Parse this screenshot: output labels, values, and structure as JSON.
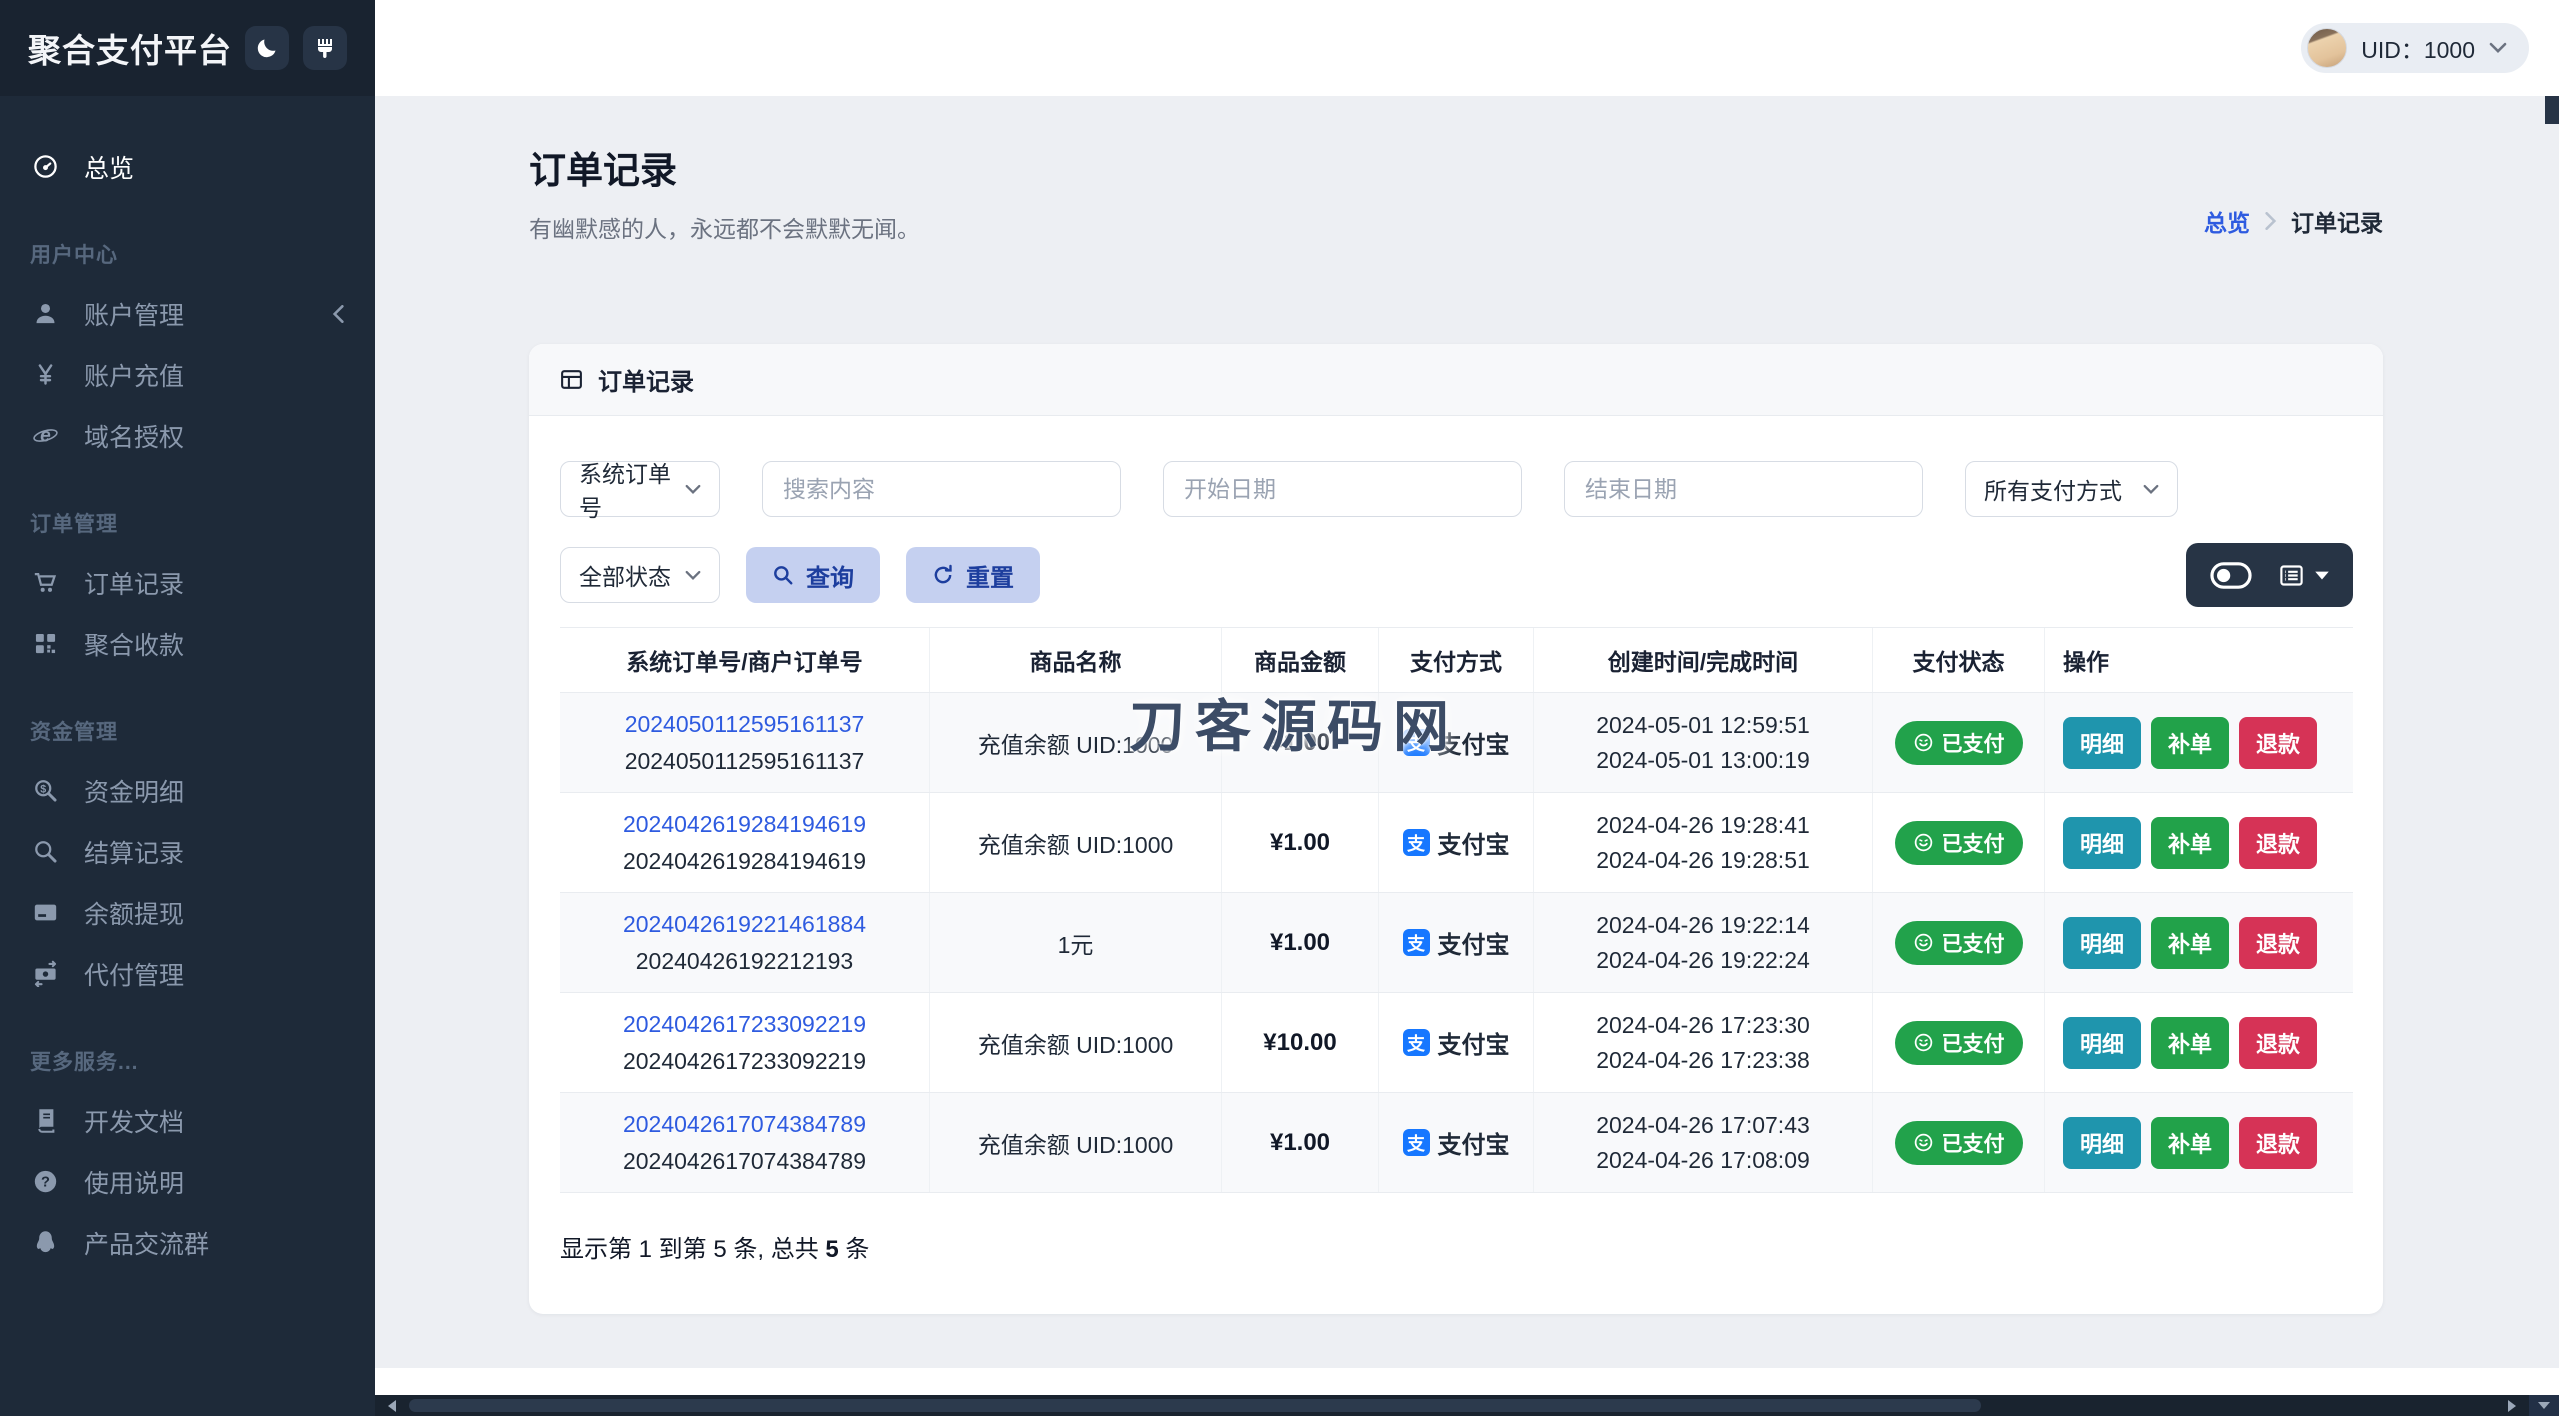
{
  "app_title": "聚合支付平台",
  "topbar": {
    "uid": "UID：1000"
  },
  "sidebar": {
    "sections": [
      {
        "label": "",
        "items": [
          {
            "icon": "gauge-icon",
            "label": "总览",
            "active": true
          }
        ]
      },
      {
        "label": "用户中心",
        "items": [
          {
            "icon": "user-icon",
            "label": "账户管理",
            "chevron": true
          },
          {
            "icon": "yen-icon",
            "label": "账户充值"
          },
          {
            "icon": "globe-icon",
            "label": "域名授权"
          }
        ]
      },
      {
        "label": "订单管理",
        "items": [
          {
            "icon": "cart-icon",
            "label": "订单记录"
          },
          {
            "icon": "qrcode-icon",
            "label": "聚合收款"
          }
        ]
      },
      {
        "label": "资金管理",
        "items": [
          {
            "icon": "search-dollar-icon",
            "label": "资金明细"
          },
          {
            "icon": "search-icon",
            "label": "结算记录"
          },
          {
            "icon": "card-icon",
            "label": "余额提现"
          },
          {
            "icon": "transfer-icon",
            "label": "代付管理"
          }
        ]
      },
      {
        "label": "更多服务...",
        "items": [
          {
            "icon": "book-icon",
            "label": "开发文档"
          },
          {
            "icon": "question-icon",
            "label": "使用说明"
          },
          {
            "icon": "qq-icon",
            "label": "产品交流群"
          }
        ]
      }
    ]
  },
  "page": {
    "title": "订单记录",
    "subtitle": "有幽默感的人，永远都不会默默无闻。",
    "breadcrumb_home": "总览",
    "breadcrumb_current": "订单记录"
  },
  "card": {
    "title": "订单记录",
    "filters": {
      "order_field": "系统订单号",
      "search_placeholder": "搜索内容",
      "start_placeholder": "开始日期",
      "end_placeholder": "结束日期",
      "pay_method": "所有支付方式",
      "status": "全部状态",
      "query": "查询",
      "reset": "重置"
    },
    "table": {
      "headers": [
        "系统订单号/商户订单号",
        "商品名称",
        "商品金额",
        "支付方式",
        "创建时间/完成时间",
        "支付状态",
        "操作"
      ],
      "pay_label": "支付宝",
      "alipay_glyph": "支",
      "status_label": "已支付",
      "actions": [
        "明细",
        "补单",
        "退款"
      ],
      "rows": [
        {
          "sys_no": "2024050112595161137",
          "merchant_no": "2024050112595161137",
          "product": "充值余额 UID:1000",
          "amount": "¥1.00",
          "created": "2024-05-01 12:59:51",
          "completed": "2024-05-01 13:00:19"
        },
        {
          "sys_no": "2024042619284194619",
          "merchant_no": "2024042619284194619",
          "product": "充值余额 UID:1000",
          "amount": "¥1.00",
          "created": "2024-04-26 19:28:41",
          "completed": "2024-04-26 19:28:51"
        },
        {
          "sys_no": "2024042619221461884",
          "merchant_no": "20240426192212193",
          "product": "1元",
          "amount": "¥1.00",
          "created": "2024-04-26 19:22:14",
          "completed": "2024-04-26 19:22:24"
        },
        {
          "sys_no": "2024042617233092219",
          "merchant_no": "2024042617233092219",
          "product": "充值余额 UID:1000",
          "amount": "¥10.00",
          "created": "2024-04-26 17:23:30",
          "completed": "2024-04-26 17:23:38"
        },
        {
          "sys_no": "2024042617074384789",
          "merchant_no": "2024042617074384789",
          "product": "充值余额 UID:1000",
          "amount": "¥1.00",
          "created": "2024-04-26 17:07:43",
          "completed": "2024-04-26 17:08:09"
        }
      ]
    },
    "footer": {
      "prefix": "显示第 1 到第 5 条, 总共 ",
      "total": "5",
      "suffix": " 条"
    }
  },
  "watermark": "刀客源码网",
  "colors": {
    "accent_blue": "#2e5be0",
    "soft_button_bg": "#c5d0f0",
    "soft_button_text": "#1d3e9e",
    "success_green": "#22a24b",
    "detail_teal": "#1f95ad",
    "refund_red": "#d63356",
    "alipay_blue": "#1677ff",
    "sidebar_bg": "#1e2a39"
  }
}
